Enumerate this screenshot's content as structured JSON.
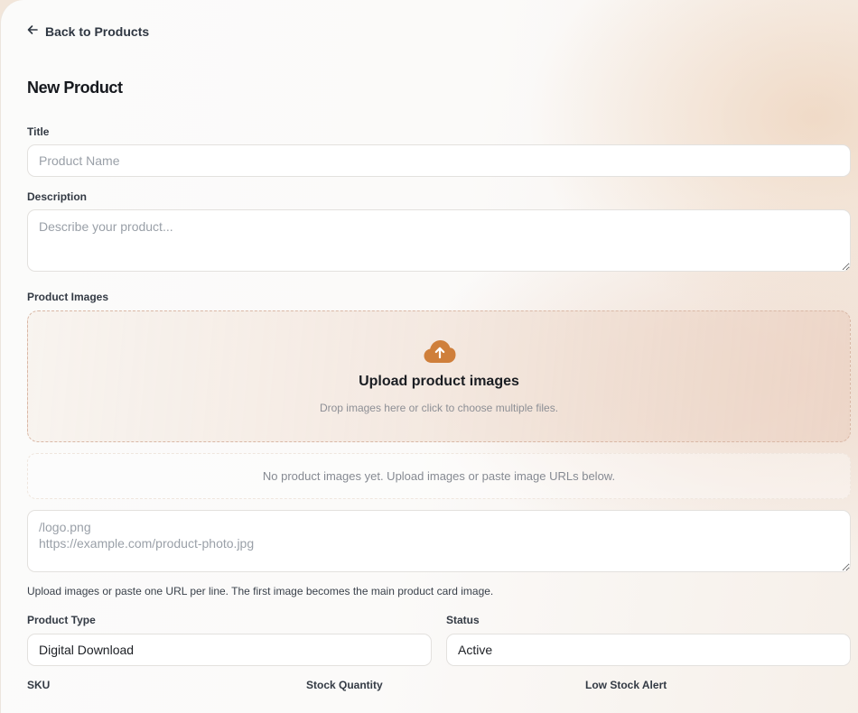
{
  "nav": {
    "back_label": "Back to Products"
  },
  "page": {
    "title": "New Product"
  },
  "form": {
    "title": {
      "label": "Title",
      "placeholder": "Product Name",
      "value": ""
    },
    "description": {
      "label": "Description",
      "placeholder": "Describe your product...",
      "value": ""
    },
    "images": {
      "label": "Product Images",
      "upload_title": "Upload product images",
      "upload_subtitle": "Drop images here or click to choose multiple files.",
      "empty_state": "No product images yet. Upload images or paste image URLs below.",
      "url_placeholder": "/logo.png\nhttps://example.com/product-photo.jpg",
      "hint": "Upload images or paste one URL per line. The first image becomes the main product card image."
    },
    "product_type": {
      "label": "Product Type",
      "value": "Digital Download"
    },
    "status": {
      "label": "Status",
      "value": "Active"
    },
    "sku": {
      "label": "SKU"
    },
    "stock_quantity": {
      "label": "Stock Quantity"
    },
    "low_stock_alert": {
      "label": "Low Stock Alert"
    }
  },
  "colors": {
    "accent": "#cf7f3b",
    "border": "#e3e1de",
    "dropzone_border": "#d9b8a6"
  },
  "icons": {
    "back": "arrow-left-icon",
    "upload": "cloud-upload-icon"
  }
}
